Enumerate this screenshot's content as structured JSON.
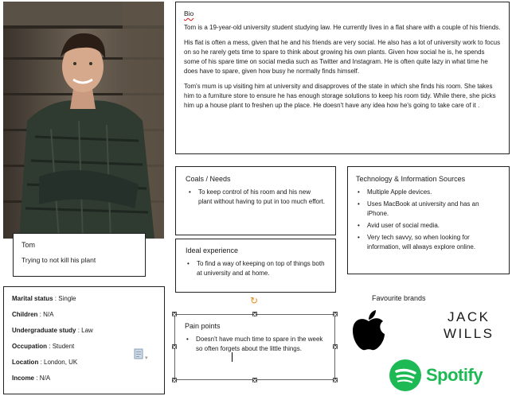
{
  "persona": {
    "name": "Tom",
    "tagline": "Trying to not kill his plant"
  },
  "bio": {
    "heading": "Bio",
    "paragraphs": [
      "Tom is a 19-year-old university student studying law. He currently lives in a flat share with a couple of his friends.",
      "His flat is often a mess, given that he and his friends are very social. He also has a lot of university work to focus on so he rarely gets time to spare to think about growing his own plants. Given how social he is, he spends some of his spare time on social media such as Twitter and Instagram. He is often quite lazy in what time he does have to spare, given how busy he normally finds himself.",
      "Tom's mum is up visiting him at university and disapproves of the state in which she finds his room. She takes him to a furniture store to ensure he has enough storage solutions to keep his room tidy. While there, she picks him up a house plant to freshen up the place. He doesn't have any idea how he's going to take care of it ."
    ]
  },
  "coals": {
    "heading": "Coals / Needs",
    "items": [
      "To keep control of his room and his new plant without having to put in too much effort."
    ]
  },
  "ideal": {
    "heading": "Ideal experience",
    "items": [
      "To find a way of keeping on top of things both at university and at home."
    ]
  },
  "tech": {
    "heading": "Technology & Information Sources",
    "items": [
      "Multiple Apple devices.",
      "Uses MacBook at university and has an iPhone.",
      "Avid user of social media.",
      "Very tech savvy, so when looking for information, will always explore online."
    ]
  },
  "pain": {
    "heading": "Pain points",
    "items": [
      "Doesn't have much time to spare in the week so often forgets about the little things."
    ]
  },
  "facts": {
    "rows": [
      {
        "label": "Marital status",
        "value": "Single"
      },
      {
        "label": "Children",
        "value": "N/A"
      },
      {
        "label": "Undergraduate study",
        "value": "Law"
      },
      {
        "label": "Occupation",
        "value": "Student"
      },
      {
        "label": "Location",
        "value": "London, UK"
      },
      {
        "label": "Income",
        "value": "N/A"
      }
    ]
  },
  "brands": {
    "heading": "Favourite brands",
    "jack_line1": "JACK",
    "jack_line2": "WILLS",
    "spotify": "Spotify",
    "apple_icon": "apple-logo-icon",
    "spotify_icon": "spotify-logo-icon",
    "spotify_color": "#1db954"
  }
}
